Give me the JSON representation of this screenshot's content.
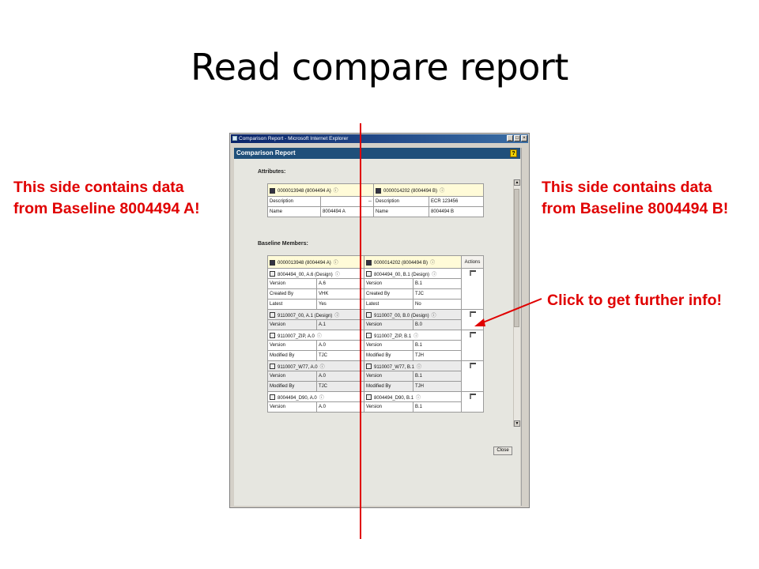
{
  "slide": {
    "title": "Read compare report",
    "note_a_line1": "This side contains data",
    "note_a_line2": "from Baseline 8004494 A!",
    "note_b_line1": "This side contains data",
    "note_b_line2": "from Baseline 8004494 B!",
    "note_c": "Click to get further info!",
    "accent_color": "#e00000"
  },
  "window": {
    "title": "Comparison Report - Microsoft Internet Explorer",
    "header": "Comparison Report",
    "help": "?",
    "min": "_",
    "max": "□",
    "close": "×",
    "close_button": "Close"
  },
  "attributes": {
    "label": "Attributes:",
    "left_header": "0000013948 (8004494 A)",
    "right_header": "0000014202 (8004494 B)",
    "rows": [
      {
        "l_key": "Description",
        "l_val": "--",
        "r_key": "Description",
        "r_val": "ECR 123456"
      },
      {
        "l_key": "Name",
        "l_val": "8004494 A",
        "r_key": "Name",
        "r_val": "8004494 B"
      }
    ]
  },
  "members": {
    "label": "Baseline Members:",
    "left_header": "0000013948 (8004494 A)",
    "right_header": "0000014202 (8004494 B)",
    "actions_header": "Actions",
    "groups": [
      {
        "l_title": "8004494_00, A.6 (Design)",
        "r_title": "8004494_00, B.1 (Design)",
        "rows": [
          [
            "Version",
            "A.6",
            "Version",
            "B.1"
          ],
          [
            "Created By",
            "VHK",
            "Created By",
            "TJC"
          ],
          [
            "Latest",
            "Yes",
            "Latest",
            "No"
          ]
        ]
      },
      {
        "l_title": "9110007_00, A.1 (Design)",
        "r_title": "9110007_00, B.0 (Design)",
        "rows": [
          [
            "Version",
            "A.1",
            "Version",
            "B.0"
          ]
        ]
      },
      {
        "l_title": "9110007_ZIP, A.0",
        "r_title": "9110007_ZIP, B.1",
        "rows": [
          [
            "Version",
            "A.0",
            "Version",
            "B.1"
          ],
          [
            "Modified By",
            "TJC",
            "Modified By",
            "TJH"
          ]
        ]
      },
      {
        "l_title": "9110007_W77, A.0",
        "r_title": "9110007_W77, B.1",
        "rows": [
          [
            "Version",
            "A.0",
            "Version",
            "B.1"
          ],
          [
            "Modified By",
            "TJC",
            "Modified By",
            "TJH"
          ]
        ]
      },
      {
        "l_title": "8004494_D90, A.0",
        "r_title": "8004494_D90, B.1",
        "rows": [
          [
            "Version",
            "A.0",
            "Version",
            "B.1"
          ]
        ]
      }
    ]
  }
}
